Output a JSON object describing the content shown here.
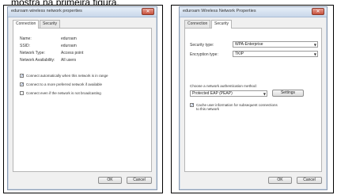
{
  "caption": "mostra na primeira figura.",
  "left_dialog": {
    "title": "eduroam wireless network properties",
    "close_glyph": "✕",
    "tabs": [
      "Connection",
      "Security"
    ],
    "fields": [
      {
        "label": "Name:",
        "value": "eduroam"
      },
      {
        "label": "SSID:",
        "value": "eduroam"
      },
      {
        "label": "Network Type:",
        "value": "Access point"
      },
      {
        "label": "Network Availability:",
        "value": "All users"
      }
    ],
    "checkboxes": [
      {
        "label": "Connect automatically when this network is in range",
        "checked": true
      },
      {
        "label": "Connect to a more preferred network if available",
        "checked": true
      },
      {
        "label": "Connect even if the network is not broadcasting",
        "checked": false
      }
    ],
    "ok_label": "OK",
    "cancel_label": "Cancel"
  },
  "right_dialog": {
    "title": "eduroam Wireless Network Properties",
    "close_glyph": "✕",
    "tabs": [
      "Connection",
      "Security"
    ],
    "security_type_label": "Security type:",
    "security_type_value": "WPA-Enterprise",
    "encryption_type_label": "Encryption type:",
    "encryption_type_value": "TKIP",
    "auth_method_label": "Choose a network authentication method:",
    "auth_method_value": "Protected EAP (PEAP)",
    "settings_label": "Settings",
    "remember_label_1": "Cache user information for subsequent connections",
    "remember_label_2": "to this network",
    "remember_checked": true,
    "ok_label": "OK",
    "cancel_label": "Cancel"
  },
  "check_glyph": "✓",
  "dropdown_glyph": "▼"
}
